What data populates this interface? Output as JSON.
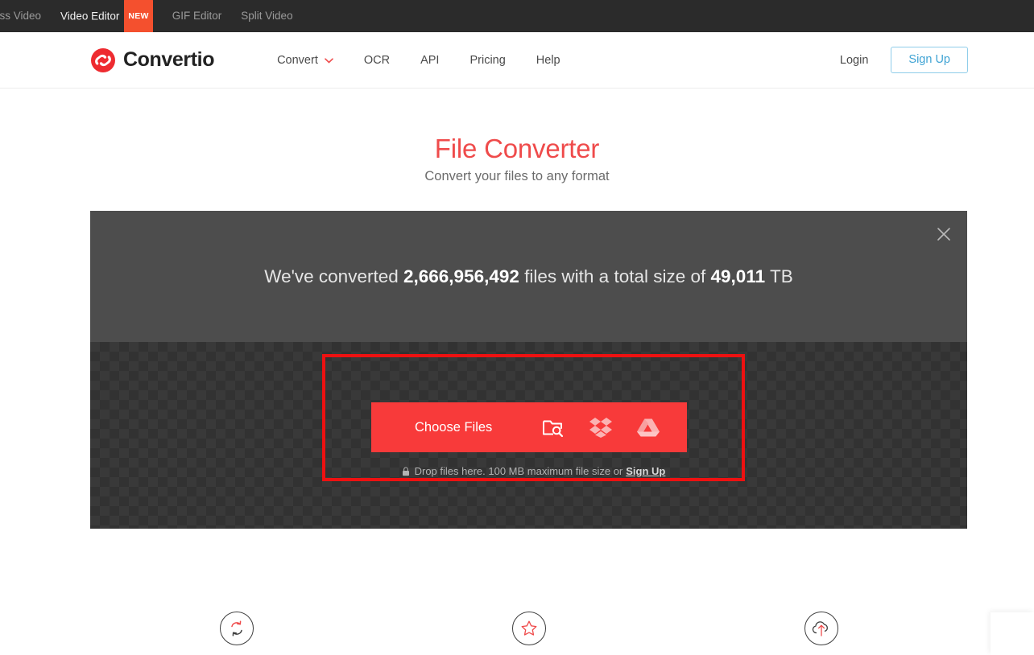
{
  "topbar": {
    "items": [
      {
        "label": "ess Video",
        "active": false,
        "badge": ""
      },
      {
        "label": "Video Editor",
        "active": true,
        "badge": "NEW"
      },
      {
        "label": "GIF Editor",
        "active": false,
        "badge": ""
      },
      {
        "label": "Split Video",
        "active": false,
        "badge": ""
      }
    ]
  },
  "header": {
    "logo_text": "Convertio",
    "logo_icon": "convertio-swirl-icon",
    "nav": [
      {
        "label": "Convert",
        "has_chevron": true
      },
      {
        "label": "OCR",
        "has_chevron": false
      },
      {
        "label": "API",
        "has_chevron": false
      },
      {
        "label": "Pricing",
        "has_chevron": false
      },
      {
        "label": "Help",
        "has_chevron": false
      }
    ],
    "login_label": "Login",
    "signup_label": "Sign Up"
  },
  "hero": {
    "title": "File Converter",
    "subtitle": "Convert your files to any format"
  },
  "stats": {
    "prefix": "We've converted",
    "files_count": "2,666,956,492",
    "middle": "files with a total size of",
    "total_size": "49,011",
    "suffix": "TB",
    "close_icon": "close-icon"
  },
  "dropzone": {
    "choose_files_label": "Choose Files",
    "browse_icon": "folder-search-icon",
    "dropbox_icon": "dropbox-icon",
    "gdrive_icon": "google-drive-icon",
    "lock_icon": "lock-icon",
    "note_text": "Drop files here. 100 MB maximum file size or",
    "note_link": "Sign Up"
  },
  "features": [
    {
      "icon": "convert-arrows-icon"
    },
    {
      "icon": "star-icon"
    },
    {
      "icon": "cloud-upload-icon"
    }
  ],
  "colors": {
    "brand_red": "#f83a3a",
    "title_red": "#ef4b4b",
    "highlight_red": "#ee1111",
    "signup_blue": "#3fa3d4",
    "banner_gray": "#4d4d4d",
    "topbar_dark": "#2b2b2b",
    "badge_orange": "#f4502e"
  }
}
